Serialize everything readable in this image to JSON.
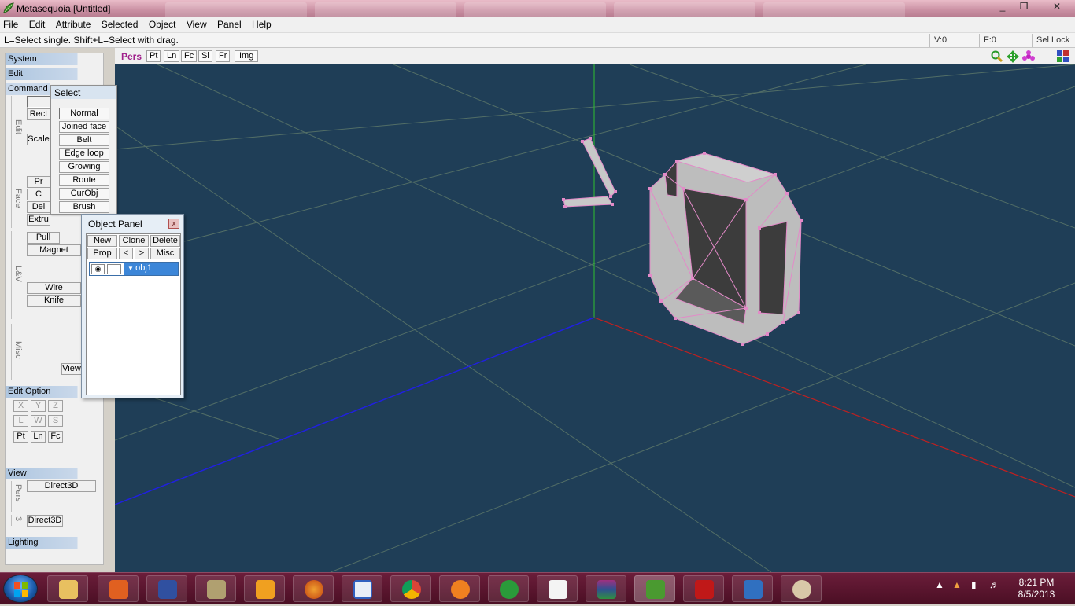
{
  "window": {
    "title": "Metasequoia [Untitled]",
    "controls": [
      "_",
      "❐",
      "✕"
    ]
  },
  "menu": [
    "File",
    "Edit",
    "Attribute",
    "Selected",
    "Object",
    "View",
    "Panel",
    "Help"
  ],
  "status": {
    "message": "L=Select single.  Shift+L=Select with drag.",
    "vertices": "V:0",
    "faces": "F:0",
    "sel_lock": "Sel Lock"
  },
  "view_toolbar": {
    "mode": "Pers",
    "buttons": [
      "Pt",
      "Ln",
      "Fc",
      "Si",
      "Fr",
      "Img"
    ]
  },
  "command_panel": {
    "system": "System",
    "edit": "Edit",
    "command": "Command",
    "group_labels": [
      "Edit",
      "Face",
      "L&V",
      "Misc"
    ],
    "edit_buttons": [
      "Rect",
      "Scale"
    ],
    "face_buttons": [
      "Pr",
      "C",
      "Del",
      "Extru"
    ],
    "lv_buttons": [
      "Pull",
      "Magnet",
      "Wire",
      "Knife"
    ],
    "misc_buttons": [
      "View"
    ],
    "edit_option": "Edit Option",
    "axis_buttons": [
      "X",
      "Y",
      "Z"
    ],
    "space_buttons": [
      "L",
      "W",
      "S"
    ],
    "type_buttons": [
      "Pt",
      "Ln",
      "Fc"
    ],
    "view": "View",
    "view_label": "Pers",
    "direct3d_top": "Direct3D",
    "view_num": "3",
    "direct3d_bottom": "Direct3D",
    "lighting": "Lighting"
  },
  "select_popup": {
    "title": "Select",
    "options": [
      "Normal",
      "Joined face",
      "Belt",
      "Edge loop",
      "Growing",
      "Route",
      "CurObj",
      "Brush"
    ]
  },
  "object_panel": {
    "title": "Object Panel",
    "close": "x",
    "row1": [
      "New",
      "Clone",
      "Delete"
    ],
    "row2": [
      "Prop",
      "<",
      ">",
      "Misc"
    ],
    "objects": [
      {
        "name": "obj1"
      }
    ]
  },
  "taskbar": {
    "apps": [
      "explorer",
      "office",
      "wizard",
      "video-editor",
      "media-player",
      "firefox",
      "document",
      "chrome",
      "blender",
      "utorrent",
      "file",
      "winrar",
      "metasequoia",
      "acrobat",
      "cutter",
      "paint"
    ],
    "time": "8:21 PM",
    "date": "8/5/2013"
  }
}
